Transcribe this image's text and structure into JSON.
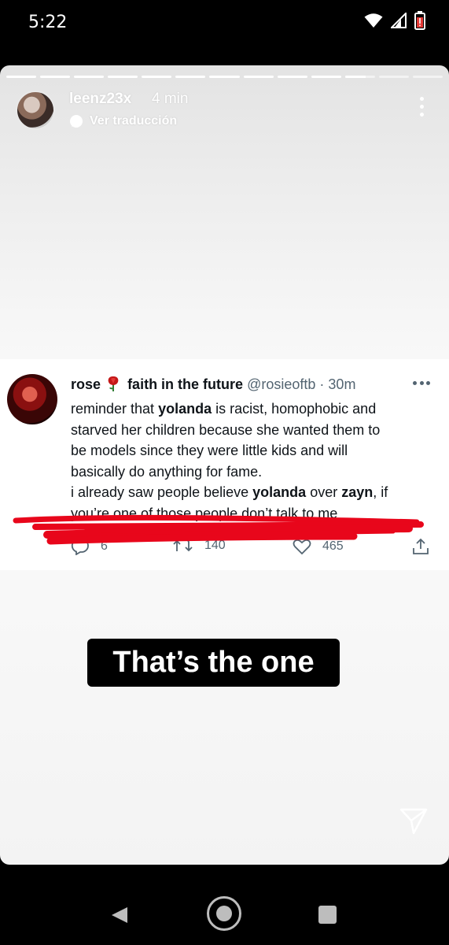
{
  "status_bar": {
    "time": "5:22"
  },
  "story": {
    "username": "leenz23x",
    "time_ago": "4 min",
    "translate_label": "Ver traducción",
    "progress": {
      "segments": 13,
      "completed": 10,
      "current_fraction": 0.7
    },
    "caption": "That’s the one"
  },
  "tweet": {
    "name": "rose",
    "name_suffix": "faith in the future",
    "handle": "@rosieoftb",
    "separator": "·",
    "time": "30m",
    "lines": [
      {
        "a": "reminder that ",
        "b": "yolanda",
        "c": " is racist, homophobic and"
      },
      {
        "a": "starved her children because she wanted them to"
      },
      {
        "a": "be models since they were little kids and will"
      },
      {
        "a": "basically do anything for fame."
      },
      {
        "a": "i already saw people believe ",
        "b": "yolanda",
        "c": " over ",
        "d": "zayn",
        "e": ", if"
      },
      {
        "a": "you’re one of those people don’t talk to me"
      }
    ],
    "replies": "6",
    "retweets": "140",
    "likes": "465"
  },
  "colors": {
    "scribble": "#e8061b",
    "card_bg": "#ffffff",
    "caption_bg": "#000000",
    "text_secondary": "#536471"
  },
  "icons": [
    "wifi-icon",
    "signal-icon",
    "battery-low-icon",
    "translate-icon",
    "more-vert-icon",
    "rose-emoji-icon",
    "reply-icon",
    "retweet-icon",
    "like-icon",
    "share-icon",
    "send-icon",
    "back-icon",
    "home-icon",
    "recents-icon"
  ]
}
